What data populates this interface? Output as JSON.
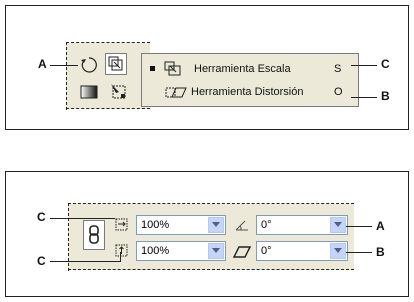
{
  "top_figure": {
    "callouts": [
      "A",
      "C",
      "B"
    ],
    "menu": {
      "items": [
        {
          "label": "Herramienta Escala",
          "shortcut": "S",
          "current": true
        },
        {
          "label": "Herramienta Distorsión",
          "shortcut": "O",
          "current": false
        }
      ]
    }
  },
  "bottom_figure": {
    "callouts_left": [
      "C",
      "C"
    ],
    "callouts_right": [
      "A",
      "B"
    ],
    "scale_x": "100%",
    "scale_y": "100%",
    "rotation": "0°",
    "shear": "0°"
  }
}
